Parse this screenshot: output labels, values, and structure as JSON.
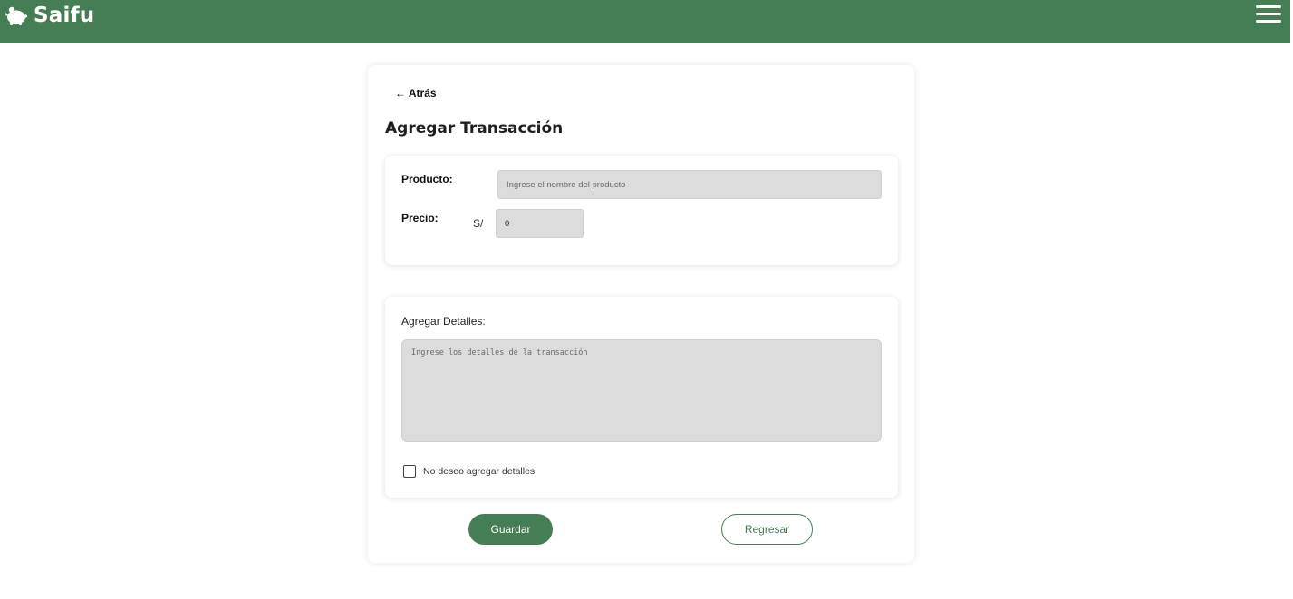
{
  "header": {
    "app_name": "Saifu",
    "brand_color": "#457e55",
    "logo_icon": "piggy-bank-icon",
    "menu_icon": "hamburger-menu-icon"
  },
  "form": {
    "back_label": "← Atrás",
    "title": "Agregar Transacción",
    "product_label": "Producto:",
    "product_placeholder": "Ingrese el nombre del producto",
    "price_label": "Precio:",
    "currency": "S/",
    "price_value": "0",
    "details_label": "Agregar Detalles:",
    "details_placeholder": "Ingrese los detalles de la transacción",
    "no_details_label": "No deseo agregar detalles",
    "no_details_checked": false,
    "save_label": "Guardar",
    "return_label": "Regresar"
  }
}
